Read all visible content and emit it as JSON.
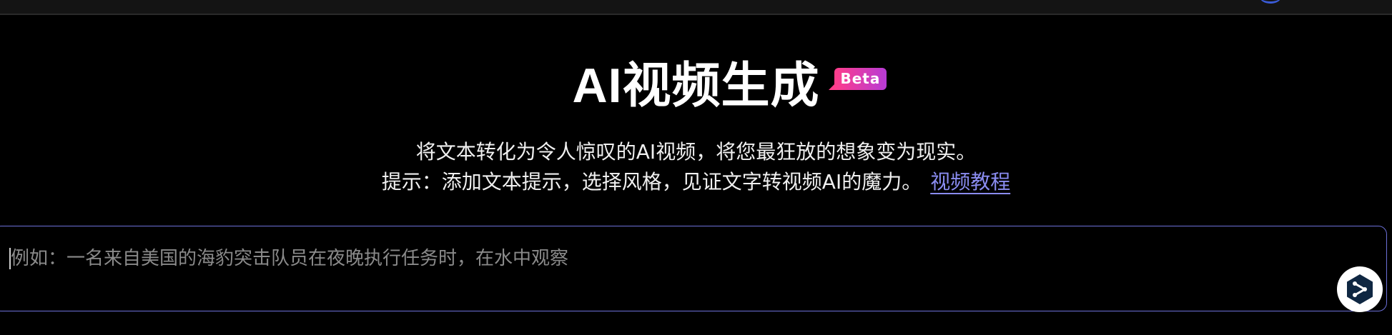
{
  "hero": {
    "title": "AI视频生成",
    "badge": "Beta",
    "description_line1": "将文本转化为令人惊叹的AI视频，将您最狂放的想象变为现实。",
    "description_line2": "提示：添加文本提示，选择风格，见证文字转视频AI的魔力。",
    "tutorial_link": "视频教程"
  },
  "prompt": {
    "placeholder": "例如：一名来自美国的海豹突击队员在夜晚执行任务时，在水中观察",
    "value": ""
  },
  "floating_button": {
    "icon": "share-send-icon"
  },
  "colors": {
    "background": "#000000",
    "accent": "#6c70d8",
    "link": "#8a8cf0",
    "badge_start": "#ff3d8a",
    "badge_end": "#b83bd6"
  }
}
